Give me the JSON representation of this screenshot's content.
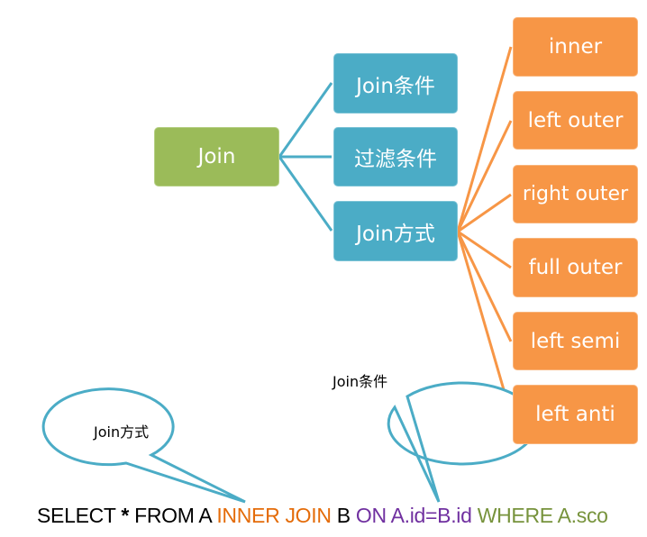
{
  "colors": {
    "root": "#9BBB59",
    "level1": "#4BACC6",
    "level2": "#F79646",
    "sql_keyword_join": "#E46C0A",
    "sql_on": "#7030A0",
    "sql_where": "#77933C"
  },
  "root": {
    "label": "Join"
  },
  "level1": [
    {
      "label": "Join条件"
    },
    {
      "label": "过滤条件"
    },
    {
      "label": "Join方式"
    }
  ],
  "join_types": [
    {
      "label": "inner"
    },
    {
      "label": "left outer"
    },
    {
      "label": "right outer"
    },
    {
      "label": "full outer"
    },
    {
      "label": "left semi"
    },
    {
      "label": "left anti"
    }
  ],
  "callouts": [
    {
      "label": "Join方式"
    },
    {
      "label": "Join条件"
    }
  ],
  "sql": {
    "part1": "SELECT ",
    "star": "*",
    "part2": " FROM A ",
    "join": "INNER JOIN",
    "part3": " B ",
    "on": "ON A.id=B.id",
    "where": " WHERE  A.sco"
  }
}
